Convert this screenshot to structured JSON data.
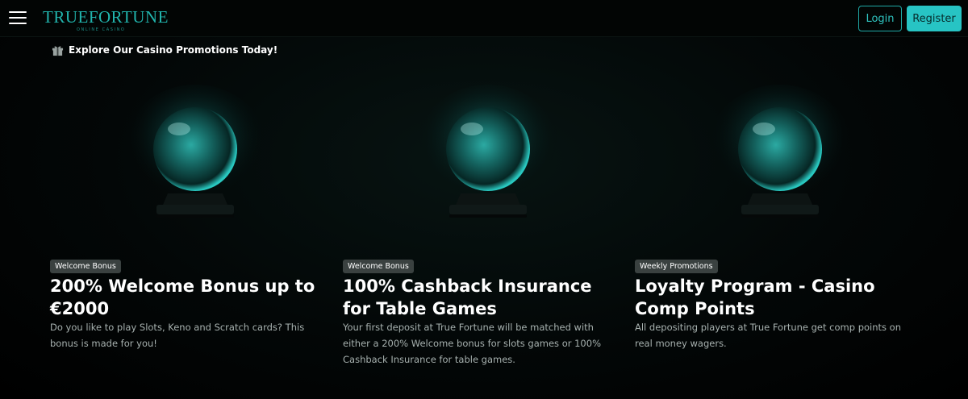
{
  "header": {
    "logo_main": "TRUEFORTUNE",
    "logo_sub": "ONLINE CASINO",
    "menu_icon": "hamburger-menu-icon",
    "login_label": "Login",
    "register_label": "Register"
  },
  "section": {
    "icon": "gift-icon",
    "title": "Explore Our Casino Promotions Today!"
  },
  "promotions": [
    {
      "badge": "Welcome Bonus",
      "title": "200% Welcome Bonus up to €2000",
      "description": "Do you like to play Slots, Keno and Scratch cards? This bonus is made for you!",
      "image": "crystal-ball"
    },
    {
      "badge": "Welcome Bonus",
      "title": "100% Cashback Insurance for Table Games",
      "description": "Your first deposit at True Fortune will be matched with either a 200% Welcome bonus for slots games or 100% Cashback Insurance for table games.",
      "image": "crystal-ball"
    },
    {
      "badge": "Weekly Promotions",
      "title": "Loyalty Program - Casino Comp Points",
      "description": "All depositing players at True Fortune get comp points on real money wagers.",
      "image": "crystal-ball"
    }
  ],
  "colors": {
    "accent": "#27c4c4",
    "logo": "#21b4ad",
    "badge_bg": "#3a4140",
    "text_muted": "#a7b1af",
    "background": "#000000"
  }
}
